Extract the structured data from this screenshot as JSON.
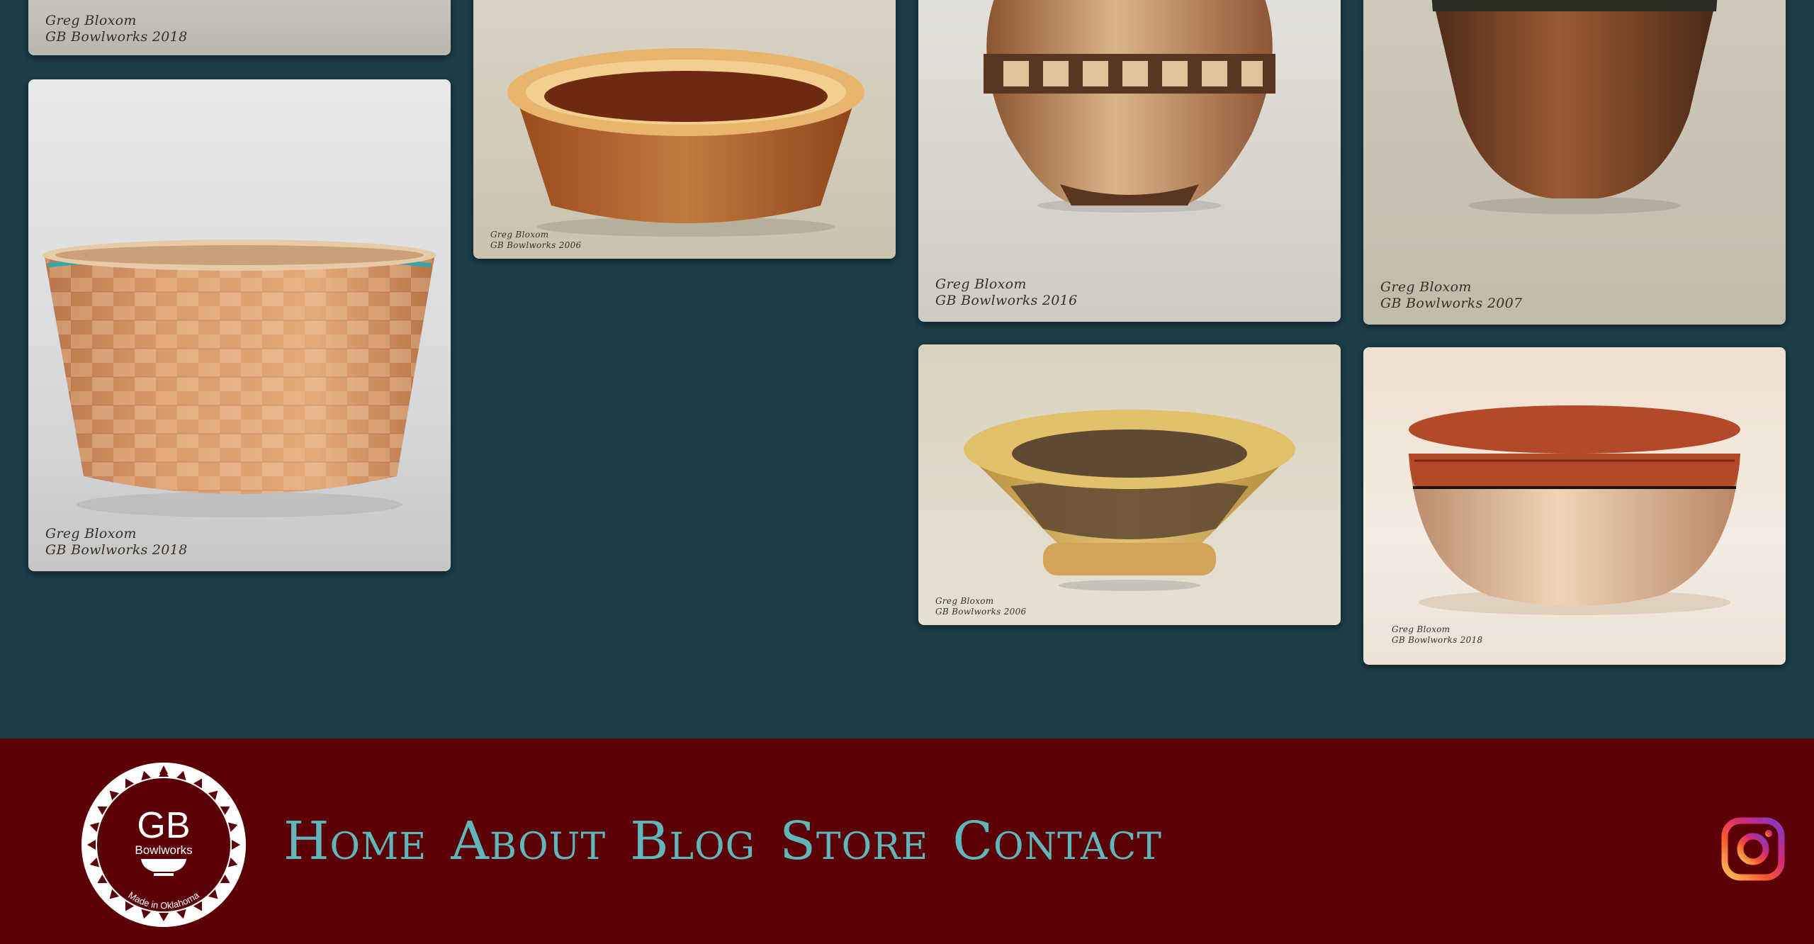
{
  "gallery": {
    "items": [
      {
        "id": "a1",
        "signature": [
          "Greg Bloxom",
          "GB Bowlworks 2018"
        ]
      },
      {
        "id": "a2",
        "signature": [
          "Greg Bloxom",
          "GB Bowlworks 2018"
        ]
      },
      {
        "id": "b1",
        "signature": [
          "Greg Bloxom",
          "GB Bowlworks 2006"
        ]
      },
      {
        "id": "c1",
        "signature": [
          "Greg Bloxom",
          "GB Bowlworks 2016"
        ]
      },
      {
        "id": "c2",
        "signature": [
          "Greg Bloxom",
          "GB Bowlworks 2006"
        ]
      },
      {
        "id": "d1",
        "signature": [
          "Greg Bloxom",
          "GB Bowlworks 2007"
        ]
      },
      {
        "id": "d2",
        "signature": [
          "Greg Bloxom",
          "GB Bowlworks 2018"
        ]
      }
    ]
  },
  "footer": {
    "logo": {
      "initials": "GB",
      "name": "Bowlworks",
      "tagline": "Made in Oklahoma"
    },
    "nav": [
      "Home",
      "About",
      "Blog",
      "Store",
      "Contact"
    ],
    "social_icon": "instagram-icon"
  },
  "colors": {
    "background": "#1b3d47",
    "footer": "#5c0007",
    "nav": "#5fb7bc"
  }
}
